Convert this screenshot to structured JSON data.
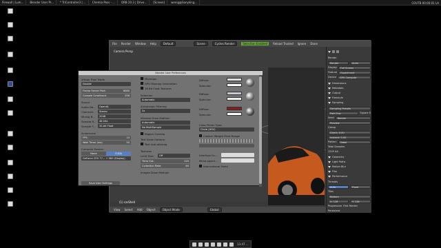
{
  "taskbar": {
    "tasks": [
      "Firewall | Lum...",
      "Blender User Pr...",
      "* TriController3 | ...",
      "Chemia Pass - ...",
      "ORB 20.3 | Drive...",
      "[Screen]",
      "wenig@Sanyking..."
    ],
    "tray_text": "COUTB 00:00:01 LA",
    "clock_label": "13:47 ..."
  },
  "desktop_icons": [
    "",
    "",
    "",
    "",
    "",
    "",
    "",
    "",
    "",
    "",
    "",
    "",
    "",
    ""
  ],
  "blender": {
    "menu": [
      "File",
      "Render",
      "Window",
      "Help"
    ],
    "layout": "Default",
    "scene": "Scene",
    "engine": "Cycles Render",
    "status": [
      "Selection Enabled",
      "Reload Trusted",
      "Ignore",
      "Done"
    ],
    "viewport_label": "Camera Persp",
    "object_status": "(1) carShell",
    "footer": [
      "View",
      "Select",
      "Add",
      "Object",
      "Object Mode",
      "Global"
    ],
    "props": {
      "render_label": "Render",
      "render_btn": "Render",
      "anim_btn": "Anim",
      "display_label": "Display",
      "display_val": "Full Screen",
      "feature_label": "Feature",
      "feature_val": "Experiment",
      "device_label": "Device",
      "device_val": "GPU Compute",
      "sections": [
        "Dimensions",
        "Metadata",
        "Output",
        "Freestyle",
        "Sampling"
      ],
      "sampling_preset": "Sampling Presets",
      "path_trac": "Path Trac",
      "square": "Square S",
      "seed": "Seed",
      "render_s": "Render",
      "preview": "Preview",
      "clamp": "Clamp",
      "direct": "Direct: 0.00",
      "indirect": "Indirect: 0.00",
      "pattern": "Pattern",
      "sobol": "Sobol",
      "total": "Total Samples",
      "sample_count": "1225 AA",
      "sections2": [
        "Geometry",
        "Light Paths",
        "Motion Blur",
        "Film",
        "Performance"
      ],
      "threads": "Threads",
      "auto": "Auto",
      "fixed": "Fixed",
      "tiles": "Tiles",
      "bottom": "Bottom",
      "tile_x": "X: 128",
      "tile_y": "Y: 128",
      "progressive": "Progressive",
      "first_render": "First Render",
      "persistent": "Persistent"
    }
  },
  "prefs": {
    "title": "Blender User Preferences",
    "col1": {
      "virtual_pixel": "Virtual Pixel Mode",
      "virtual_val": "Double",
      "frame_server": "Frame Server Port:",
      "frame_val": "8080",
      "console_scroll": "Console Scrollback:",
      "console_val": "256",
      "sound": "Sound",
      "audio_dev": "Audio De...",
      "audio_val": "OpenAL",
      "channels": "Channels",
      "channels_val": "Stereo",
      "mixing": "Mixing B...",
      "mixing_val": "2048",
      "sample_r": "Sample R...",
      "sample_r_val": "48 kHz",
      "sample_f": "Sample F...",
      "sample_f_val": "32-bit Float",
      "screencast": "Screencast",
      "fps": "FPS:",
      "fps_val": "10",
      "wait": "Wait Timer (ms)",
      "wait_val": "50",
      "compute": "Compute Device:",
      "none": "None",
      "cuda": "CUDA",
      "gpu": "GeForce GTX 77...",
      "gpu2": "+ 980 (Display)",
      "save": "Save User Settings"
    },
    "col2": {
      "mipmaps": "Mipmaps",
      "gpu_mipmap": "GPU Mipmap Generation",
      "float_tex": "16 Bit Float Textures",
      "selection": "Selection",
      "selection_val": "Automatic",
      "anisotropic": "Anisotropic Filtering",
      "aniso_val": "2x",
      "window_draw": "Window Draw Method:",
      "window_val": "Automatic",
      "multisample": "No MultiSample",
      "region_overlap": "Region Overlap",
      "text_draw": "Text Draw Options:",
      "text_aa": "Text Anti-aliasing",
      "textures": "Textures",
      "limit_size": "Limit Size:",
      "limit_val": "Off",
      "time_out": "Time Out:",
      "time_val": "120",
      "collection": "Collection Rate:",
      "collection_val": "60",
      "images_draw": "Images Draw Method:"
    },
    "col3": {
      "diffuse": "Diffuse:",
      "specular": "Specular:",
      "color_picker": "Color Picker Type:",
      "color_val": "Circle (HSV)",
      "custom_weight": "Custom Weight Paint Range",
      "interface_font": "Interface Fo...",
      "mono_font": "Mono-space...",
      "intl_fonts": "International Fonts"
    }
  },
  "colors": {
    "viewport_bg": "#3c3c3c",
    "dialog_bg": "#727272",
    "accent_blue": "#5680c2",
    "car_orange": "#c65a1e"
  }
}
